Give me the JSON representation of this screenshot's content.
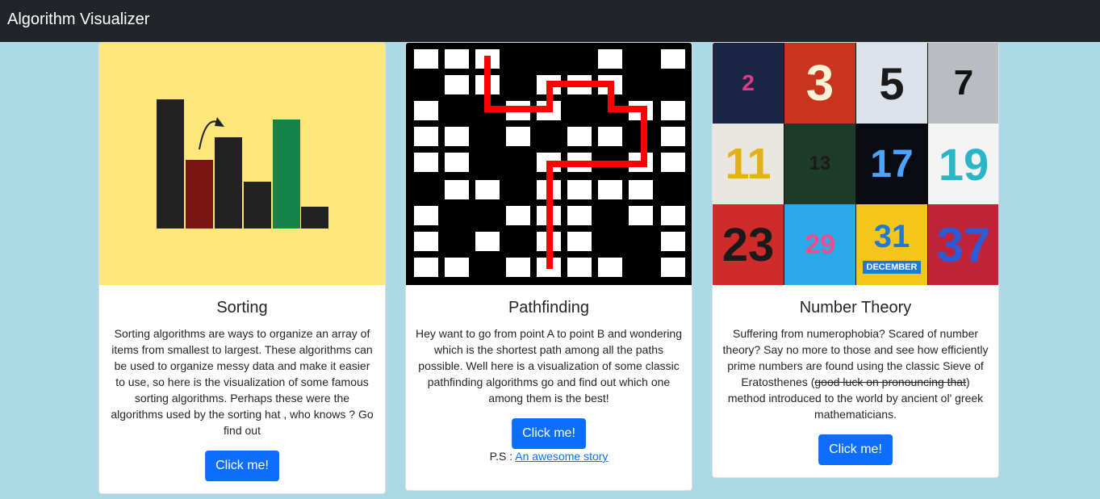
{
  "app": {
    "title": "Algorithm Visualizer"
  },
  "colors": {
    "navbar": "#212529",
    "background": "#add8e6",
    "button": "#0d6efd"
  },
  "cards": [
    {
      "title": "Sorting",
      "text": "Sorting algorithms are ways to organize an array of items from smallest to largest. These algorithms can be used to organize messy data and make it easier to use, so here is the visualization of some famous sorting algorithms. Perhaps these were the algorithms used by the sorting hat , who knows ? Go find out",
      "button": "Click me!"
    },
    {
      "title": "Pathfinding",
      "text": "Hey want to go from point A to point B and wondering which is the shortest path among all the paths possible. Well here is a visualization of some classic pathfinding algorithms go and find out which one among them is the best!",
      "button": "Click me!",
      "ps_label": "P.S : ",
      "ps_link": "An awesome story"
    },
    {
      "title": "Number Theory",
      "text_before": "Suffering from numerophobia? Scared of number theory? Say no more to those and see how efficiently prime numbers are found using the classic Sieve of Eratosthenes (",
      "text_strike": "good luck on pronouncing that",
      "text_after": ") method introduced to the world by ancient ol' greek mathematicians.",
      "button": "Click me!",
      "primes": [
        "2",
        "3",
        "5",
        "7",
        "11",
        "13",
        "17",
        "19",
        "23",
        "29",
        "31",
        "37"
      ],
      "banner": "DECEMBER"
    }
  ]
}
